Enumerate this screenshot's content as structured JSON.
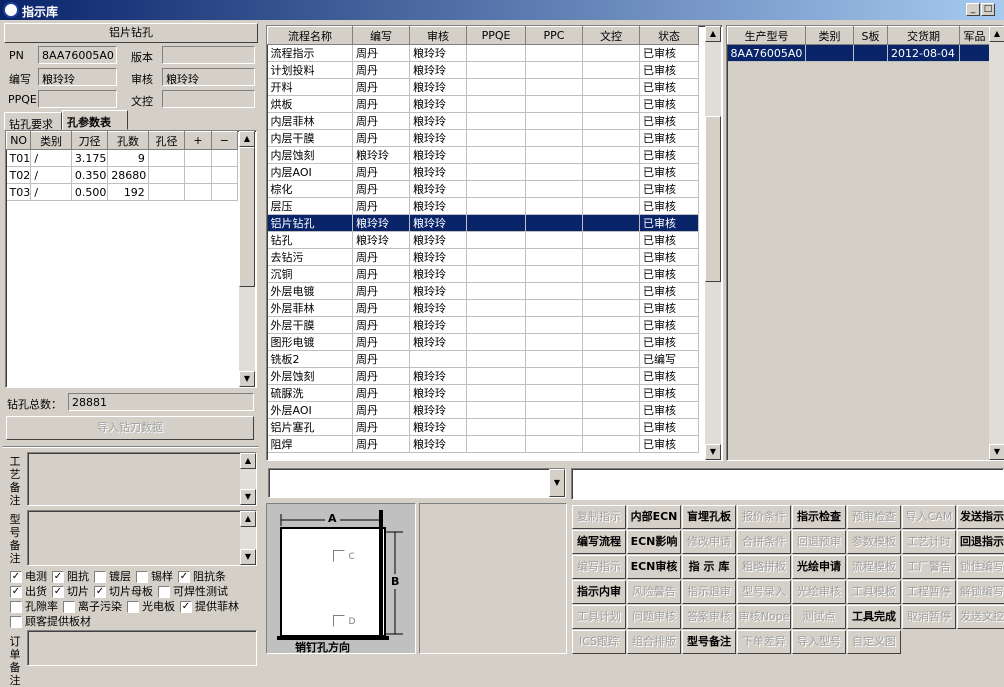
{
  "window": {
    "title": "指示库",
    "min_label": "_",
    "max_label": "□"
  },
  "left": {
    "header": "铝片钻孔",
    "fields": {
      "pn_label": "PN",
      "pn_value": "8AA76005A0",
      "version_label": "版本",
      "version_value": "",
      "editor_label": "编写",
      "editor_value": "粮玲玲",
      "reviewer_label": "审核",
      "reviewer_value": "粮玲玲",
      "ppqe_label": "PPQE",
      "ppqe_value": "",
      "control_label": "文控",
      "control_value": ""
    },
    "tabs": [
      "钻孔要求",
      "孔参数表"
    ],
    "hole_table": {
      "columns": [
        "NO",
        "类别",
        "刀径",
        "孔数",
        "孔径",
        "+",
        "−"
      ],
      "rows": [
        [
          "T01",
          "/",
          "3.175",
          "9",
          ""
        ],
        [
          "T02",
          "/",
          "0.350",
          "28680",
          ""
        ],
        [
          "T03",
          "/",
          "0.500",
          "192",
          ""
        ]
      ]
    },
    "total_label": "钻孔总数：",
    "total_value": "28881",
    "import_button": "导入钻刀数据",
    "process_note_label": "工艺备注",
    "model_note_label": "型号备注",
    "checkboxes": [
      [
        {
          "label": "电测",
          "checked": true
        },
        {
          "label": "阻抗",
          "checked": true
        },
        {
          "label": "镀层",
          "checked": false
        },
        {
          "label": "锡样",
          "checked": false
        },
        {
          "label": "阻抗条",
          "checked": true
        }
      ],
      [
        {
          "label": "出货",
          "checked": true
        },
        {
          "label": "切片",
          "checked": true
        },
        {
          "label": "切片母板",
          "checked": true
        },
        {
          "label": "可焊性测试",
          "checked": false
        }
      ],
      [
        {
          "label": "孔隙率",
          "checked": false
        },
        {
          "label": "离子污染",
          "checked": false
        },
        {
          "label": "光电板",
          "checked": false
        },
        {
          "label": "提供菲林",
          "checked": true
        }
      ],
      [
        {
          "label": "顾客提供板材",
          "checked": false
        }
      ]
    ],
    "order_note_label": "订单备注"
  },
  "process_table": {
    "columns": [
      "流程名称",
      "编写",
      "审核",
      "PPQE",
      "PPC",
      "文控",
      "状态"
    ],
    "rows": [
      [
        "流程指示",
        "周丹",
        "粮玲玲",
        "",
        "",
        "",
        "已审核"
      ],
      [
        "计划投料",
        "周丹",
        "粮玲玲",
        "",
        "",
        "",
        "已审核"
      ],
      [
        "开料",
        "周丹",
        "粮玲玲",
        "",
        "",
        "",
        "已审核"
      ],
      [
        "烘板",
        "周丹",
        "粮玲玲",
        "",
        "",
        "",
        "已审核"
      ],
      [
        "内层菲林",
        "周丹",
        "粮玲玲",
        "",
        "",
        "",
        "已审核"
      ],
      [
        "内层干膜",
        "周丹",
        "粮玲玲",
        "",
        "",
        "",
        "已审核"
      ],
      [
        "内层蚀刻",
        "粮玲玲",
        "粮玲玲",
        "",
        "",
        "",
        "已审核"
      ],
      [
        "内层AOI",
        "周丹",
        "粮玲玲",
        "",
        "",
        "",
        "已审核"
      ],
      [
        "棕化",
        "周丹",
        "粮玲玲",
        "",
        "",
        "",
        "已审核"
      ],
      [
        "层压",
        "周丹",
        "粮玲玲",
        "",
        "",
        "",
        "已审核"
      ],
      [
        "铝片钻孔",
        "粮玲玲",
        "粮玲玲",
        "",
        "",
        "",
        "已审核"
      ],
      [
        "钻孔",
        "粮玲玲",
        "粮玲玲",
        "",
        "",
        "",
        "已审核"
      ],
      [
        "去钻污",
        "周丹",
        "粮玲玲",
        "",
        "",
        "",
        "已审核"
      ],
      [
        "沉铜",
        "周丹",
        "粮玲玲",
        "",
        "",
        "",
        "已审核"
      ],
      [
        "外层电镀",
        "周丹",
        "粮玲玲",
        "",
        "",
        "",
        "已审核"
      ],
      [
        "外层菲林",
        "周丹",
        "粮玲玲",
        "",
        "",
        "",
        "已审核"
      ],
      [
        "外层干膜",
        "周丹",
        "粮玲玲",
        "",
        "",
        "",
        "已审核"
      ],
      [
        "图形电镀",
        "周丹",
        "粮玲玲",
        "",
        "",
        "",
        "已审核"
      ],
      [
        "铣板2",
        "周丹",
        "",
        "",
        "",
        "",
        "已编写"
      ],
      [
        "外层蚀刻",
        "周丹",
        "粮玲玲",
        "",
        "",
        "",
        "已审核"
      ],
      [
        "硫脲洗",
        "周丹",
        "粮玲玲",
        "",
        "",
        "",
        "已审核"
      ],
      [
        "外层AOI",
        "周丹",
        "粮玲玲",
        "",
        "",
        "",
        "已审核"
      ],
      [
        "铝片塞孔",
        "周丹",
        "粮玲玲",
        "",
        "",
        "",
        "已审核"
      ],
      [
        "阻焊",
        "周丹",
        "粮玲玲",
        "",
        "",
        "",
        "已审核"
      ]
    ]
  },
  "model_table": {
    "columns": [
      "生产型号",
      "类别",
      "S板",
      "交货期",
      "军品"
    ],
    "rows": [
      [
        "8AA76005A0",
        "",
        "",
        "2012-08-04",
        ""
      ]
    ]
  },
  "diagram": {
    "label_a": "A",
    "label_b": "B",
    "label_c": "C",
    "label_d": "D",
    "caption": "销钉孔方向"
  },
  "actions": [
    [
      {
        "label": "复制指示",
        "s": "off"
      },
      {
        "label": "内部ECN",
        "s": "on"
      },
      {
        "label": "盲埋孔板",
        "s": "on"
      },
      {
        "label": "报价条件",
        "s": "off"
      },
      {
        "label": "指示检查",
        "s": "on"
      },
      {
        "label": "预审检查",
        "s": "off"
      },
      {
        "label": "导入CAM",
        "s": "off"
      },
      {
        "label": "发送指示",
        "s": "on"
      }
    ],
    [
      {
        "label": "编写流程",
        "s": "on"
      },
      {
        "label": "ECN影响",
        "s": "on"
      },
      {
        "label": "修改申请",
        "s": "off"
      },
      {
        "label": "合拼条件",
        "s": "off"
      },
      {
        "label": "回退预审",
        "s": "off"
      },
      {
        "label": "参数模板",
        "s": "off"
      },
      {
        "label": "工艺计时",
        "s": "off"
      },
      {
        "label": "回退指示",
        "s": "on"
      }
    ],
    [
      {
        "label": "编写指示",
        "s": "off"
      },
      {
        "label": "ECN审核",
        "s": "on"
      },
      {
        "label": "指 示 库",
        "s": "on"
      },
      {
        "label": "粗略拼板",
        "s": "off"
      },
      {
        "label": "光绘申请",
        "s": "on"
      },
      {
        "label": "流程模板",
        "s": "off"
      },
      {
        "label": "工厂警告",
        "s": "off"
      },
      {
        "label": "锁住编写",
        "s": "off"
      }
    ],
    [
      {
        "label": "指示内审",
        "s": "on"
      },
      {
        "label": "风险警告",
        "s": "off"
      },
      {
        "label": "指示退审",
        "s": "off"
      },
      {
        "label": "型号录入",
        "s": "off"
      },
      {
        "label": "光绘审核",
        "s": "off"
      },
      {
        "label": "工具模板",
        "s": "off"
      },
      {
        "label": "工程暂停",
        "s": "off"
      },
      {
        "label": "解锁编写",
        "s": "off"
      }
    ],
    [
      {
        "label": "工具计划",
        "s": "off"
      },
      {
        "label": "问题审核",
        "s": "off"
      },
      {
        "label": "答案审核",
        "s": "off"
      },
      {
        "label": "审核Nope",
        "s": "off"
      },
      {
        "label": "测试点",
        "s": "off"
      },
      {
        "label": "工具完成",
        "s": "on"
      },
      {
        "label": "取消暂停",
        "s": "off"
      },
      {
        "label": "发送文控",
        "s": "off"
      }
    ],
    [
      {
        "label": "ICS跟踪",
        "s": "off"
      },
      {
        "label": "组合排版",
        "s": "off"
      },
      {
        "label": "型号备注",
        "s": "on"
      },
      {
        "label": "下单差异",
        "s": "off"
      },
      {
        "label": "导入型号",
        "s": "off"
      },
      {
        "label": "自定义图",
        "s": "off"
      }
    ]
  ]
}
